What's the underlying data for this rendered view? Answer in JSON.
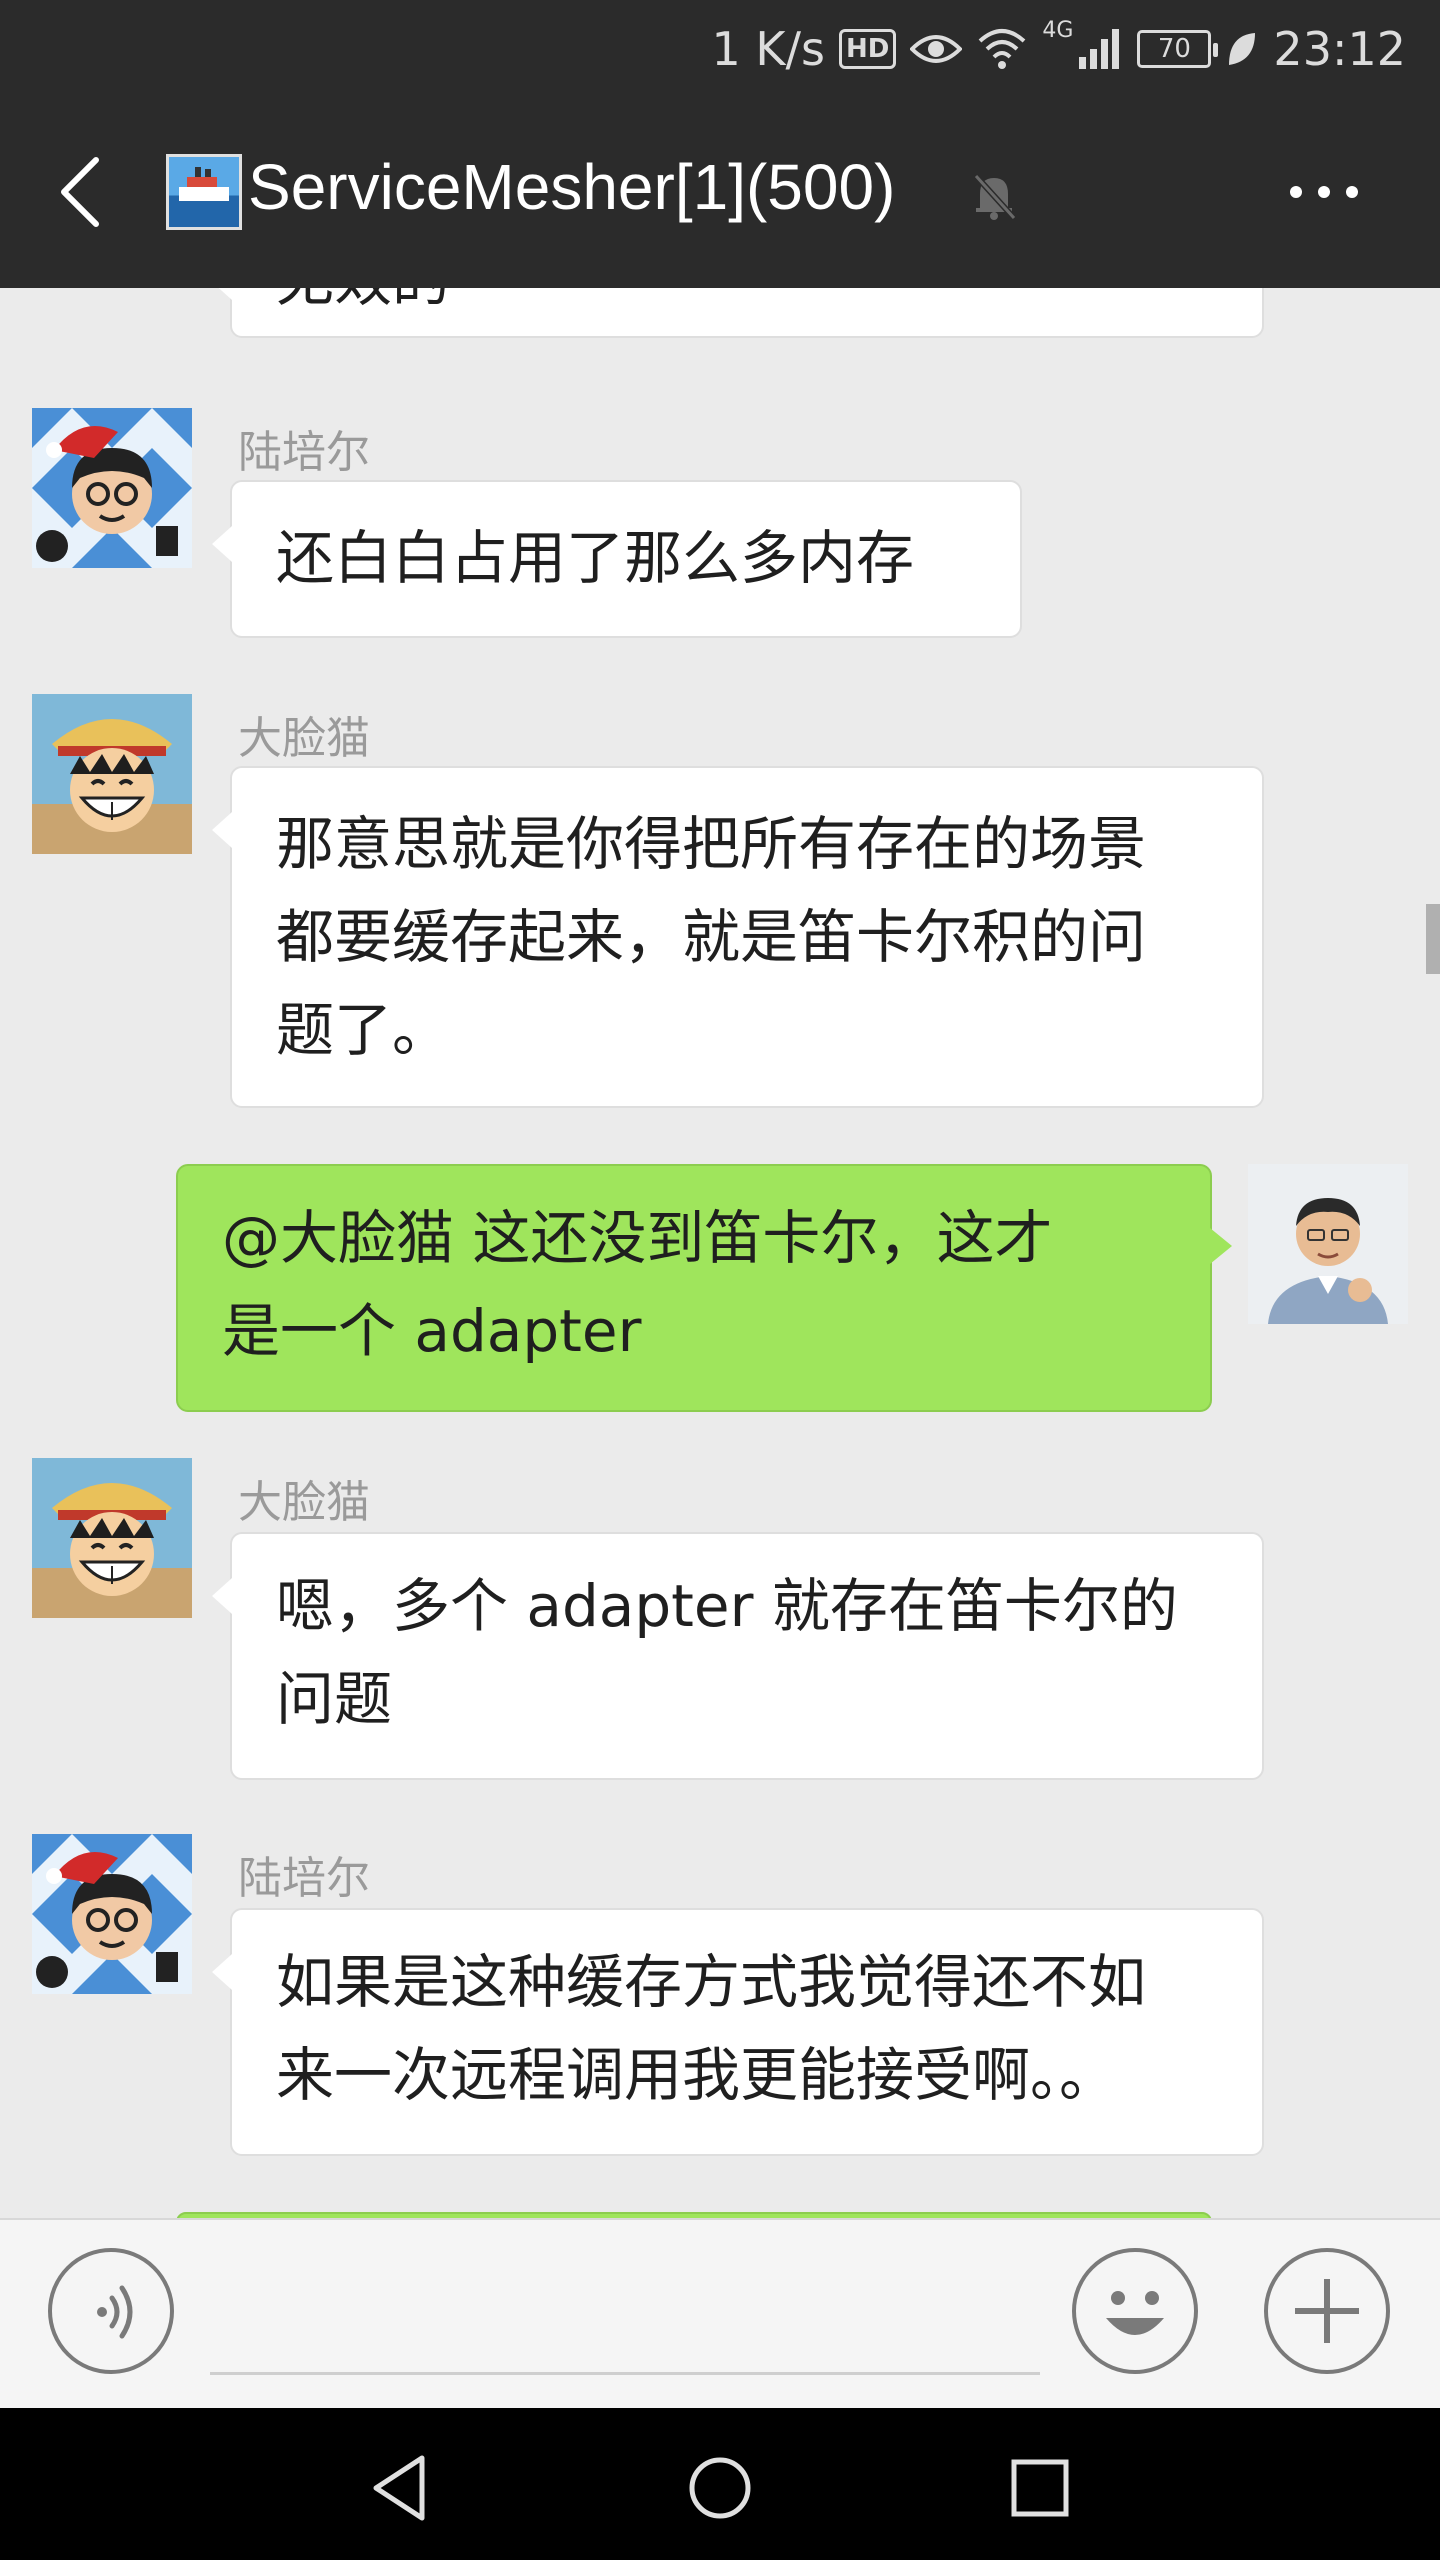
{
  "status_bar": {
    "net_speed": "1 K/s",
    "hd": "HD",
    "network": "4G",
    "battery": "70",
    "time": "23:12"
  },
  "title_bar": {
    "title": "ServiceMesher[1](500)"
  },
  "messages": [
    {
      "type": "in",
      "sender": "",
      "lines": [
        "无效的"
      ],
      "avatar": "avatar-partial"
    },
    {
      "type": "in",
      "sender": "陆培尔",
      "lines": [
        "还白白占用了那么多内存"
      ],
      "avatar": "avatar-luperr"
    },
    {
      "type": "in",
      "sender": "大脸猫",
      "lines": [
        "那意思就是你得把所有存在的场景",
        "都要缓存起来，就是笛卡尔积的问",
        "题了。"
      ],
      "avatar": "avatar-daliannmao"
    },
    {
      "type": "out",
      "sender": "",
      "lines": [
        "@大脸猫  这还没到笛卡尔，这才",
        "是一个 adapter"
      ],
      "avatar": "avatar-self"
    },
    {
      "type": "in",
      "sender": "大脸猫",
      "lines": [
        "嗯，多个 adapter 就存在笛卡尔的",
        "问题"
      ],
      "avatar": "avatar-daliannmao"
    },
    {
      "type": "in",
      "sender": "陆培尔",
      "lines": [
        "如果是这种缓存方式我觉得还不如",
        "来一次远程调用我更能接受啊。。"
      ],
      "avatar": "avatar-luperr"
    }
  ],
  "colors": {
    "header_bg": "#2b2b2b",
    "chat_bg": "#ebebeb",
    "out_bubble": "#9fe55c",
    "in_bubble": "#ffffff"
  }
}
